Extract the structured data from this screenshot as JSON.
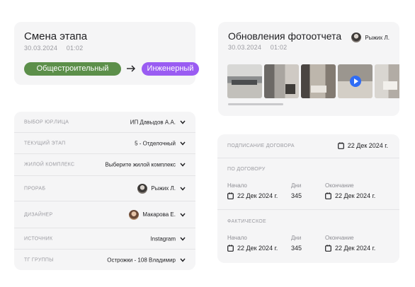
{
  "stage_card": {
    "title": "Смена этапа",
    "date": "30.03.2024",
    "time": "01:02",
    "from_stage": "Общестроительный",
    "to_stage": "Инженерный",
    "from_color": "#5c8f4a",
    "to_color": "#9a5cf2"
  },
  "photo_card": {
    "title": "Обновления фотоотчета",
    "date": "30.03.2024",
    "time": "01:02",
    "author": "Рыжих Л.",
    "thumbnails": [
      "photo-1",
      "photo-2",
      "photo-3",
      "video-4",
      "photo-5"
    ],
    "play_color": "#2f6cf5"
  },
  "fields": [
    {
      "label": "ВЫБОР ЮР.ЛИЦА",
      "value": "ИП Давыдов А.А."
    },
    {
      "label": "ТЕКУЩИЙ ЭТАП",
      "value": "5 - Отделочный"
    },
    {
      "label": "ЖИЛОЙ КОМПЛЕКС",
      "value": "Выберите жилой комплекс"
    },
    {
      "label": "ПРОРАБ",
      "value": "Рыжих Л."
    },
    {
      "label": "ДИЗАЙНЕР",
      "value": "Макарова Е."
    },
    {
      "label": "ИСТОЧНИК",
      "value": "Instagram"
    },
    {
      "label": "ТГ ГРУППЫ",
      "value": "Острожки - 108 Владимир"
    }
  ],
  "contract": {
    "signing_label": "ПОДПИСАНИЕ ДОГОВОРА",
    "signing_date": "22 Дек 2024 г.",
    "by_contract": {
      "label": "ПО ДОГОВОРУ",
      "start_label": "Начало",
      "start": "22 Дек 2024 г.",
      "days_label": "Дни",
      "days": "345",
      "end_label": "Окончание",
      "end": "22 Дек 2024 г."
    },
    "actual": {
      "label": "ФАКТИЧЕСКОЕ",
      "start_label": "Начало",
      "start": "22 Дек 2024 г.",
      "days_label": "Дни",
      "days": "345",
      "end_label": "Окончание",
      "end": "22 Дек 2024 г."
    }
  }
}
